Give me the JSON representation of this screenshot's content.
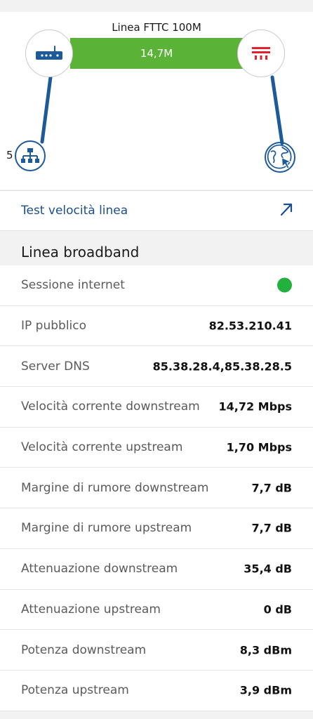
{
  "diagram": {
    "line_title": "Linea FTTC 100M",
    "speed": "14,7M",
    "lan_count": "5",
    "router_icon": "router-icon",
    "provider_icon": "tim-logo-icon",
    "lan_icon": "lan-network-icon",
    "internet_icon": "globe-cursor-icon",
    "colors": {
      "bar": "#5ab337",
      "line": "#1c5a9a"
    }
  },
  "action": {
    "label": "Test velocità linea",
    "icon": "external-arrow-icon"
  },
  "section": {
    "title": "Linea broadband"
  },
  "rows": [
    {
      "label": "Sessione internet",
      "value": "",
      "status": "connected",
      "status_color": "#21b13c"
    },
    {
      "label": "IP pubblico",
      "value": "82.53.210.41"
    },
    {
      "label": "Server DNS",
      "value": "85.38.28.4,85.38.28.5"
    },
    {
      "label": "Velocità corrente downstream",
      "value": "14,72 Mbps"
    },
    {
      "label": "Velocità corrente upstream",
      "value": "1,70 Mbps"
    },
    {
      "label": "Margine di rumore downstream",
      "value": "7,7 dB"
    },
    {
      "label": "Margine di rumore upstream",
      "value": "7,7 dB"
    },
    {
      "label": "Attenuazione downstream",
      "value": "35,4 dB"
    },
    {
      "label": "Attenuazione upstream",
      "value": "0 dB"
    },
    {
      "label": "Potenza downstream",
      "value": "8,3 dBm"
    },
    {
      "label": "Potenza upstream",
      "value": "3,9 dBm"
    }
  ]
}
